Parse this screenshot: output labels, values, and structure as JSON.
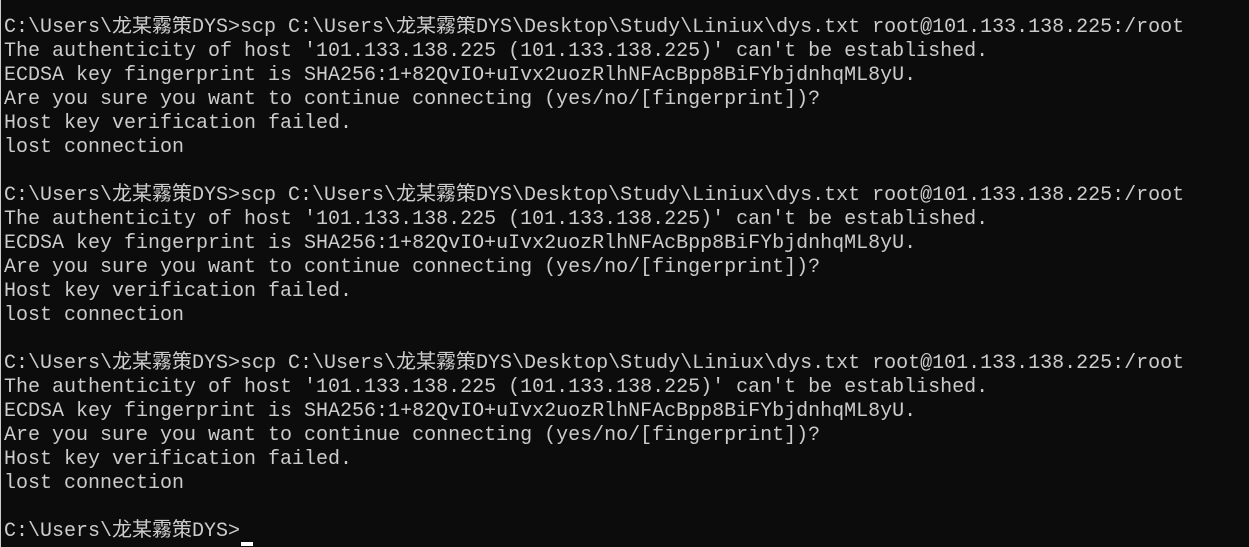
{
  "terminal": {
    "background": "#0c0c0c",
    "foreground": "#cccccc",
    "cursor_color": "#ffffff",
    "lines": [
      "C:\\Users\\龙某霧策DYS>scp C:\\Users\\龙某霧策DYS\\Desktop\\Study\\Liniux\\dys.txt root@101.133.138.225:/root",
      "The authenticity of host '101.133.138.225 (101.133.138.225)' can't be established.",
      "ECDSA key fingerprint is SHA256:1+82QvIO+uIvx2uozRlhNFAcBpp8BiFYbjdnhqML8yU.",
      "Are you sure you want to continue connecting (yes/no/[fingerprint])?",
      "Host key verification failed.",
      "lost connection",
      "",
      "C:\\Users\\龙某霧策DYS>scp C:\\Users\\龙某霧策DYS\\Desktop\\Study\\Liniux\\dys.txt root@101.133.138.225:/root",
      "The authenticity of host '101.133.138.225 (101.133.138.225)' can't be established.",
      "ECDSA key fingerprint is SHA256:1+82QvIO+uIvx2uozRlhNFAcBpp8BiFYbjdnhqML8yU.",
      "Are you sure you want to continue connecting (yes/no/[fingerprint])?",
      "Host key verification failed.",
      "lost connection",
      "",
      "C:\\Users\\龙某霧策DYS>scp C:\\Users\\龙某霧策DYS\\Desktop\\Study\\Liniux\\dys.txt root@101.133.138.225:/root",
      "The authenticity of host '101.133.138.225 (101.133.138.225)' can't be established.",
      "ECDSA key fingerprint is SHA256:1+82QvIO+uIvx2uozRlhNFAcBpp8BiFYbjdnhqML8yU.",
      "Are you sure you want to continue connecting (yes/no/[fingerprint])?",
      "Host key verification failed.",
      "lost connection",
      ""
    ],
    "current_prompt": "C:\\Users\\龙某霧策DYS>"
  }
}
